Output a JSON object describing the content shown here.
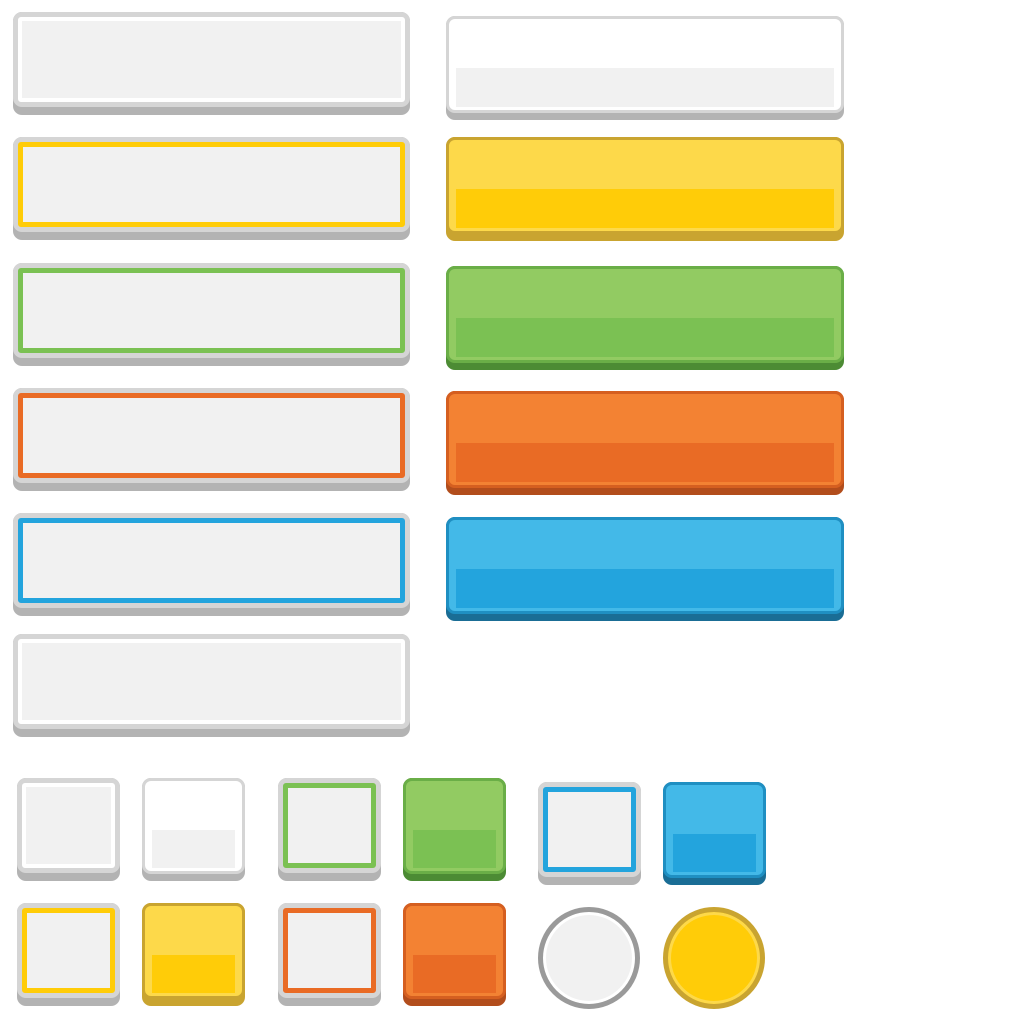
{
  "title": "",
  "colors": {
    "white": "#ffffff",
    "light_gray": "#f1f1f1",
    "rim_gray": "#d5d5d5",
    "shadow_gray": "#b3b3b3",
    "yellow": "#ffcc08",
    "yellow_light": "#fdd94a",
    "yellow_dark": "#c9a430",
    "green": "#7bc153",
    "green_light": "#92cb62",
    "green_dark": "#4c8b34",
    "orange": "#e96b25",
    "orange_light": "#f38233",
    "orange_dark": "#b24d1c",
    "blue": "#23a4dd",
    "blue_light": "#43b9e8",
    "blue_dark": "#1a6d95",
    "circle_rim_gray": "#9a9a9a"
  },
  "buttons": {
    "wide_outline": [
      "white",
      "yellow",
      "green",
      "orange",
      "blue",
      "plain"
    ],
    "wide_filled": [
      "white",
      "yellow",
      "green",
      "orange",
      "blue"
    ],
    "square_row1": [
      "white-outline",
      "white-filled",
      "green-outline",
      "green-filled",
      "blue-outline",
      "blue-filled"
    ],
    "square_row2": [
      "yellow-outline",
      "yellow-filled",
      "orange-outline",
      "orange-filled",
      "gray-circle",
      "yellow-circle"
    ]
  }
}
